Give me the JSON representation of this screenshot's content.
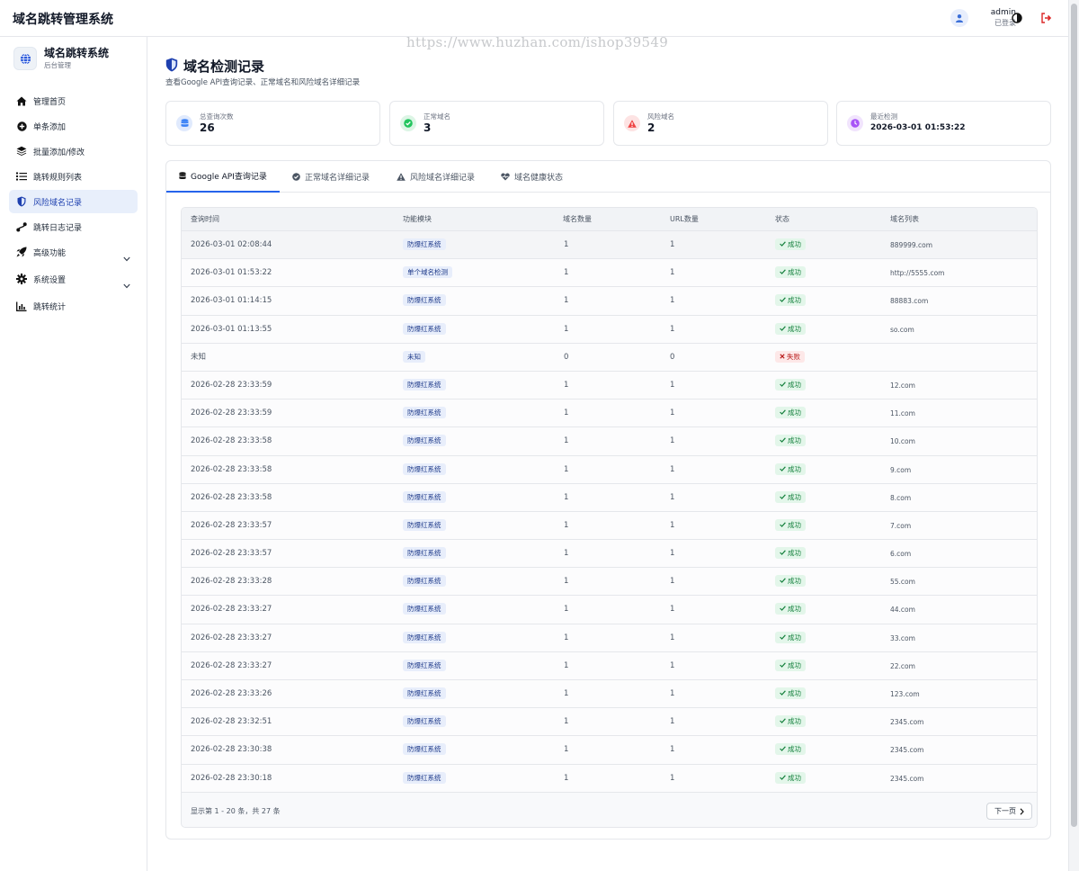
{
  "header": {
    "app_title": "域名跳转管理系统",
    "user_name": "admin",
    "user_status": "已登录",
    "watermark": "https://www.huzhan.com/ishop39549"
  },
  "sidebar": {
    "brand_name": "域名跳转系统",
    "brand_sub": "后台管理",
    "items": [
      {
        "label": "管理首页",
        "icon": "home-icon"
      },
      {
        "label": "单条添加",
        "icon": "plus-circle-icon"
      },
      {
        "label": "批量添加/修改",
        "icon": "layers-icon"
      },
      {
        "label": "跳转规则列表",
        "icon": "list-icon"
      },
      {
        "label": "风险域名记录",
        "icon": "shield-icon",
        "active": true
      },
      {
        "label": "跳转日志记录",
        "icon": "route-icon"
      },
      {
        "label": "高级功能",
        "icon": "rocket-icon",
        "has_submenu": true
      },
      {
        "label": "系统设置",
        "icon": "gear-icon",
        "has_submenu": true
      },
      {
        "label": "跳转统计",
        "icon": "chart-icon"
      }
    ]
  },
  "page": {
    "title": "域名检测记录",
    "description": "查看Google API查询记录、正常域名和风险域名详细记录"
  },
  "stats": [
    {
      "label": "总查询次数",
      "value": "26",
      "color": "#3b82f6"
    },
    {
      "label": "正常域名",
      "value": "3",
      "color": "#22c55e"
    },
    {
      "label": "风险域名",
      "value": "2",
      "color": "#ef4444"
    },
    {
      "label": "最近检测",
      "value": "2026-03-01 01:53:22",
      "color": "#a855f7"
    }
  ],
  "tabs": [
    {
      "label": "Google API查询记录",
      "active": true
    },
    {
      "label": "正常域名详细记录"
    },
    {
      "label": "风险域名详细记录"
    },
    {
      "label": "域名健康状态"
    }
  ],
  "table": {
    "columns": [
      "查询时间",
      "功能模块",
      "域名数量",
      "URL数量",
      "状态",
      "域名列表"
    ],
    "rows": [
      {
        "time": "2026-03-01 02:08:44",
        "module": "防爆红系统",
        "domains": "1",
        "urls": "1",
        "status": "成功",
        "ok": true,
        "list": "889999.com"
      },
      {
        "time": "2026-03-01 01:53:22",
        "module": "单个域名检测",
        "domains": "1",
        "urls": "1",
        "status": "成功",
        "ok": true,
        "list": "http://5555.com"
      },
      {
        "time": "2026-03-01 01:14:15",
        "module": "防爆红系统",
        "domains": "1",
        "urls": "1",
        "status": "成功",
        "ok": true,
        "list": "88883.com"
      },
      {
        "time": "2026-03-01 01:13:55",
        "module": "防爆红系统",
        "domains": "1",
        "urls": "1",
        "status": "成功",
        "ok": true,
        "list": "so.com"
      },
      {
        "time": "未知",
        "module": "未知",
        "domains": "0",
        "urls": "0",
        "status": "失败",
        "ok": false,
        "list": ""
      },
      {
        "time": "2026-02-28 23:33:59",
        "module": "防爆红系统",
        "domains": "1",
        "urls": "1",
        "status": "成功",
        "ok": true,
        "list": "12.com"
      },
      {
        "time": "2026-02-28 23:33:59",
        "module": "防爆红系统",
        "domains": "1",
        "urls": "1",
        "status": "成功",
        "ok": true,
        "list": "11.com"
      },
      {
        "time": "2026-02-28 23:33:58",
        "module": "防爆红系统",
        "domains": "1",
        "urls": "1",
        "status": "成功",
        "ok": true,
        "list": "10.com"
      },
      {
        "time": "2026-02-28 23:33:58",
        "module": "防爆红系统",
        "domains": "1",
        "urls": "1",
        "status": "成功",
        "ok": true,
        "list": "9.com"
      },
      {
        "time": "2026-02-28 23:33:58",
        "module": "防爆红系统",
        "domains": "1",
        "urls": "1",
        "status": "成功",
        "ok": true,
        "list": "8.com"
      },
      {
        "time": "2026-02-28 23:33:57",
        "module": "防爆红系统",
        "domains": "1",
        "urls": "1",
        "status": "成功",
        "ok": true,
        "list": "7.com"
      },
      {
        "time": "2026-02-28 23:33:57",
        "module": "防爆红系统",
        "domains": "1",
        "urls": "1",
        "status": "成功",
        "ok": true,
        "list": "6.com"
      },
      {
        "time": "2026-02-28 23:33:28",
        "module": "防爆红系统",
        "domains": "1",
        "urls": "1",
        "status": "成功",
        "ok": true,
        "list": "55.com"
      },
      {
        "time": "2026-02-28 23:33:27",
        "module": "防爆红系统",
        "domains": "1",
        "urls": "1",
        "status": "成功",
        "ok": true,
        "list": "44.com"
      },
      {
        "time": "2026-02-28 23:33:27",
        "module": "防爆红系统",
        "domains": "1",
        "urls": "1",
        "status": "成功",
        "ok": true,
        "list": "33.com"
      },
      {
        "time": "2026-02-28 23:33:27",
        "module": "防爆红系统",
        "domains": "1",
        "urls": "1",
        "status": "成功",
        "ok": true,
        "list": "22.com"
      },
      {
        "time": "2026-02-28 23:33:26",
        "module": "防爆红系统",
        "domains": "1",
        "urls": "1",
        "status": "成功",
        "ok": true,
        "list": "123.com"
      },
      {
        "time": "2026-02-28 23:32:51",
        "module": "防爆红系统",
        "domains": "1",
        "urls": "1",
        "status": "成功",
        "ok": true,
        "list": "2345.com"
      },
      {
        "time": "2026-02-28 23:30:38",
        "module": "防爆红系统",
        "domains": "1",
        "urls": "1",
        "status": "成功",
        "ok": true,
        "list": "2345.com"
      },
      {
        "time": "2026-02-28 23:30:18",
        "module": "防爆红系统",
        "domains": "1",
        "urls": "1",
        "status": "成功",
        "ok": true,
        "list": "2345.com"
      }
    ],
    "footer": "显示第 1 - 20 条，共 27 条",
    "next_label": "下一页"
  }
}
